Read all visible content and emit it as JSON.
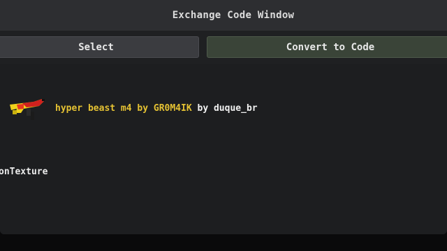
{
  "window": {
    "title": "Exchange Code Window"
  },
  "toolbar": {
    "select_label": "Select",
    "convert_label": "Convert to Code"
  },
  "item": {
    "name": "hyper beast m4 by GR0M4IK",
    "author_prefix": "by",
    "author": "duque_br",
    "icon": "weapon-skin-icon"
  },
  "texture_label": "onTexture",
  "colors": {
    "window_bg": "#1f2022",
    "titlebar_bg": "#2d2e31",
    "select_button_bg": "#3b3c40",
    "convert_button_bg": "#3a4438",
    "item_name": "#e5c233"
  }
}
